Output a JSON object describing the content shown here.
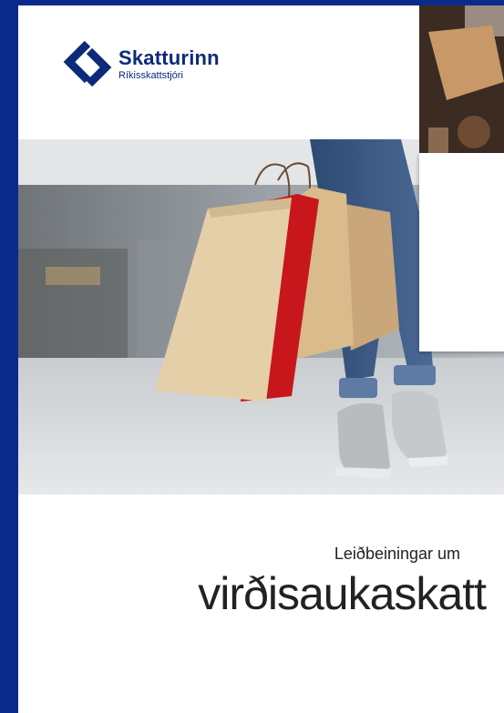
{
  "brand": {
    "name": "Skatturinn",
    "subtitle": "Ríkisskattstjóri",
    "accent": "#0b2a7a"
  },
  "cover": {
    "subtitle": "Leiðbeiningar um",
    "title": "virðisaukaskatt"
  },
  "colors": {
    "frame": "#0a2a8c",
    "bag_red": "#c8161d",
    "bag_kraft": "#d8b98a"
  }
}
